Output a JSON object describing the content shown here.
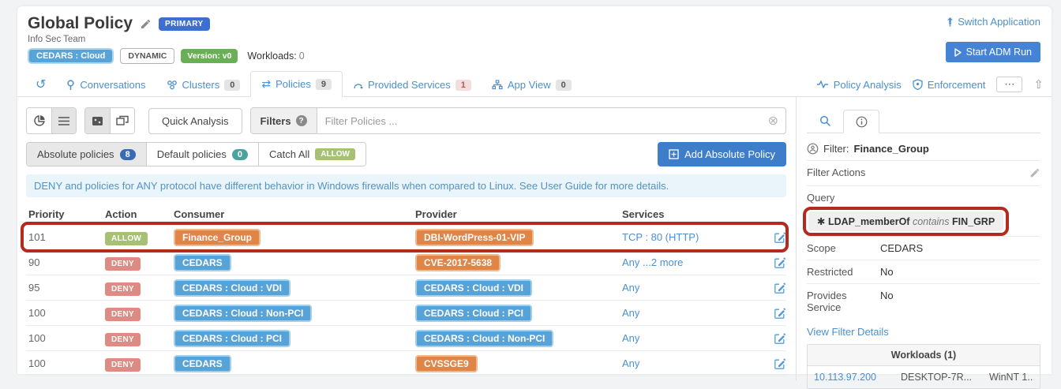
{
  "colors": {
    "accent_blue": "#4a90d0",
    "annotation_red": "#b32a1e",
    "label_blue": "#57a3d8",
    "label_orange": "#e08548",
    "allow_green": "#a6c173",
    "deny_red": "#df8b84",
    "primary_badge_blue": "#3d6fd2",
    "version_green": "#69af55"
  },
  "header": {
    "title": "Global Policy",
    "primary_badge": "PRIMARY",
    "team": "Info Sec Team",
    "scope_badge": "CEDARS : Cloud",
    "dynamic_badge": "DYNAMIC",
    "version_badge": "Version: v0",
    "workloads_label": "Workloads:",
    "workloads_count": "0",
    "switch_application": "Switch Application",
    "start_adm_run": "Start ADM Run"
  },
  "tabs": {
    "conversations": "Conversations",
    "clusters": "Clusters",
    "clusters_count": "0",
    "policies": "Policies",
    "policies_count": "9",
    "provided_services": "Provided Services",
    "provided_services_count": "1",
    "app_view": "App View",
    "app_view_count": "0",
    "policy_analysis": "Policy Analysis",
    "enforcement": "Enforcement",
    "more": "⋯",
    "collapse": "⇧"
  },
  "toolbar": {
    "quick_analysis": "Quick Analysis",
    "filters_label": "Filters",
    "filters_help": "?",
    "filter_placeholder": "Filter Policies ...",
    "clear_icon": "⊗"
  },
  "policy_tabs": {
    "absolute_label": "Absolute policies",
    "absolute_count": "8",
    "default_label": "Default policies",
    "default_count": "0",
    "catch_all_label": "Catch All",
    "catch_all_value": "ALLOW",
    "add_button": "Add Absolute Policy"
  },
  "banner_text": "DENY and policies for ANY protocol have different behavior in Windows firewalls when compared to Linux. See User Guide for more details.",
  "table": {
    "headers": [
      "Priority",
      "Action",
      "Consumer",
      "Provider",
      "Services"
    ],
    "rows": [
      {
        "priority": "101",
        "action": "ALLOW",
        "action_type": "allow",
        "consumer": "Finance_Group",
        "consumer_type": "orange",
        "provider": "DBI-WordPress-01-VIP",
        "provider_type": "orange",
        "services": "TCP : 80 (HTTP)",
        "annotated": true
      },
      {
        "priority": "90",
        "action": "DENY",
        "action_type": "deny",
        "consumer": "CEDARS",
        "consumer_type": "blue",
        "provider": "CVE-2017-5638",
        "provider_type": "orange",
        "services": "Any ...2 more",
        "annotated": false
      },
      {
        "priority": "95",
        "action": "DENY",
        "action_type": "deny",
        "consumer": "CEDARS : Cloud : VDI",
        "consumer_type": "blue",
        "provider": "CEDARS : Cloud : VDI",
        "provider_type": "blue",
        "services": "Any",
        "annotated": false
      },
      {
        "priority": "100",
        "action": "DENY",
        "action_type": "deny",
        "consumer": "CEDARS : Cloud : Non-PCI",
        "consumer_type": "blue",
        "provider": "CEDARS : Cloud : PCI",
        "provider_type": "blue",
        "services": "Any",
        "annotated": false
      },
      {
        "priority": "100",
        "action": "DENY",
        "action_type": "deny",
        "consumer": "CEDARS : Cloud : PCI",
        "consumer_type": "blue",
        "provider": "CEDARS : Cloud : Non-PCI",
        "provider_type": "blue",
        "services": "Any",
        "annotated": false
      },
      {
        "priority": "100",
        "action": "DENY",
        "action_type": "deny",
        "consumer": "CEDARS",
        "consumer_type": "blue",
        "provider": "CVSSGE9",
        "provider_type": "orange",
        "services": "Any",
        "annotated": false
      }
    ]
  },
  "side_panel": {
    "filter_label": "Filter:",
    "filter_name": "Finance_Group",
    "filter_actions_label": "Filter Actions",
    "query_label": "Query",
    "query_icon": "✱",
    "query_attr": "LDAP_memberOf",
    "query_op": "contains",
    "query_value": "FIN_GRP",
    "details": [
      {
        "label": "Scope",
        "value": "CEDARS"
      },
      {
        "label": "Restricted",
        "value": "No"
      },
      {
        "label": "Provides Service",
        "value": "No"
      }
    ],
    "view_filter_details": "View Filter Details",
    "workloads_header": "Workloads (1)",
    "workload": {
      "ip": "10.113.97.200",
      "name": "DESKTOP-7R...",
      "os": "WinNT 1..."
    }
  }
}
